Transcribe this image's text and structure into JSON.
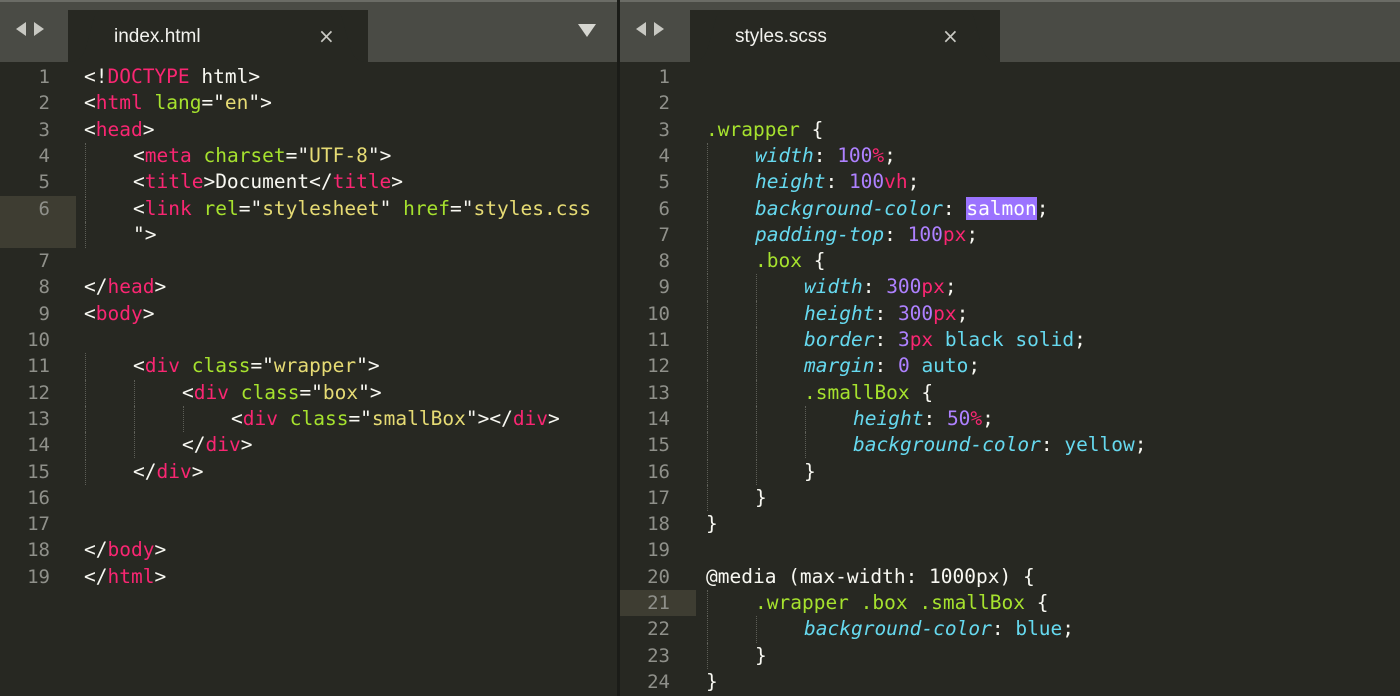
{
  "left_pane": {
    "tab_title": "index.html",
    "close_icon": "×",
    "highlighted_line": 6,
    "lines": [
      {
        "n": "1",
        "indent": 0,
        "tokens": [
          [
            "p",
            "<!"
          ],
          [
            "tag",
            "DOCTYPE"
          ],
          [
            "p",
            " html>"
          ]
        ]
      },
      {
        "n": "2",
        "indent": 0,
        "tokens": [
          [
            "p",
            "<"
          ],
          [
            "tag",
            "html"
          ],
          [
            "p",
            " "
          ],
          [
            "attr",
            "lang"
          ],
          [
            "p",
            "=\""
          ],
          [
            "str",
            "en"
          ],
          [
            "p",
            "\">"
          ]
        ]
      },
      {
        "n": "3",
        "indent": 0,
        "tokens": [
          [
            "p",
            "<"
          ],
          [
            "tag",
            "head"
          ],
          [
            "p",
            ">"
          ]
        ]
      },
      {
        "n": "4",
        "indent": 1,
        "tokens": [
          [
            "p",
            "<"
          ],
          [
            "tag",
            "meta"
          ],
          [
            "p",
            " "
          ],
          [
            "attr",
            "charset"
          ],
          [
            "p",
            "=\""
          ],
          [
            "str",
            "UTF-8"
          ],
          [
            "p",
            "\">"
          ]
        ]
      },
      {
        "n": "5",
        "indent": 1,
        "tokens": [
          [
            "p",
            "<"
          ],
          [
            "tag",
            "title"
          ],
          [
            "p",
            ">Document</"
          ],
          [
            "tag",
            "title"
          ],
          [
            "p",
            ">"
          ]
        ]
      },
      {
        "n": "6",
        "indent": 1,
        "tokens": [
          [
            "p",
            "<"
          ],
          [
            "tag",
            "link"
          ],
          [
            "p",
            " "
          ],
          [
            "attr",
            "rel"
          ],
          [
            "p",
            "=\""
          ],
          [
            "str",
            "stylesheet"
          ],
          [
            "p",
            "\" "
          ],
          [
            "attr",
            "href"
          ],
          [
            "p",
            "=\""
          ],
          [
            "str",
            "styles.css"
          ]
        ]
      },
      {
        "n": "",
        "indent": 1,
        "tokens": [
          [
            "p",
            "\">"
          ]
        ]
      },
      {
        "n": "7",
        "indent": 0,
        "tokens": []
      },
      {
        "n": "8",
        "indent": 0,
        "tokens": [
          [
            "p",
            "</"
          ],
          [
            "tag",
            "head"
          ],
          [
            "p",
            ">"
          ]
        ]
      },
      {
        "n": "9",
        "indent": 0,
        "tokens": [
          [
            "p",
            "<"
          ],
          [
            "tag",
            "body"
          ],
          [
            "p",
            ">"
          ]
        ]
      },
      {
        "n": "10",
        "indent": 0,
        "tokens": []
      },
      {
        "n": "11",
        "indent": 1,
        "tokens": [
          [
            "p",
            "<"
          ],
          [
            "tag",
            "div"
          ],
          [
            "p",
            " "
          ],
          [
            "attr",
            "class"
          ],
          [
            "p",
            "=\""
          ],
          [
            "str",
            "wrapper"
          ],
          [
            "p",
            "\">"
          ]
        ]
      },
      {
        "n": "12",
        "indent": 2,
        "tokens": [
          [
            "p",
            "<"
          ],
          [
            "tag",
            "div"
          ],
          [
            "p",
            " "
          ],
          [
            "attr",
            "class"
          ],
          [
            "p",
            "=\""
          ],
          [
            "str",
            "box"
          ],
          [
            "p",
            "\">"
          ]
        ]
      },
      {
        "n": "13",
        "indent": 3,
        "tokens": [
          [
            "p",
            "<"
          ],
          [
            "tag",
            "div"
          ],
          [
            "p",
            " "
          ],
          [
            "attr",
            "class"
          ],
          [
            "p",
            "=\""
          ],
          [
            "str",
            "smallBox"
          ],
          [
            "p",
            "\"></"
          ],
          [
            "tag",
            "div"
          ],
          [
            "p",
            ">"
          ]
        ]
      },
      {
        "n": "14",
        "indent": 2,
        "tokens": [
          [
            "p",
            "</"
          ],
          [
            "tag",
            "div"
          ],
          [
            "p",
            ">"
          ]
        ]
      },
      {
        "n": "15",
        "indent": 1,
        "tokens": [
          [
            "p",
            "</"
          ],
          [
            "tag",
            "div"
          ],
          [
            "p",
            ">"
          ]
        ]
      },
      {
        "n": "16",
        "indent": 0,
        "tokens": []
      },
      {
        "n": "17",
        "indent": 0,
        "tokens": []
      },
      {
        "n": "18",
        "indent": 0,
        "tokens": [
          [
            "p",
            "</"
          ],
          [
            "tag",
            "body"
          ],
          [
            "p",
            ">"
          ]
        ]
      },
      {
        "n": "19",
        "indent": 0,
        "tokens": [
          [
            "p",
            "</"
          ],
          [
            "tag",
            "html"
          ],
          [
            "p",
            ">"
          ]
        ]
      }
    ]
  },
  "right_pane": {
    "tab_title": "styles.scss",
    "close_icon": "×",
    "highlighted_line": 21,
    "lines": [
      {
        "n": "1",
        "indent": 0,
        "tokens": []
      },
      {
        "n": "2",
        "indent": 0,
        "tokens": []
      },
      {
        "n": "3",
        "indent": 0,
        "tokens": [
          [
            "sel",
            ".wrapper"
          ],
          [
            "p",
            " {"
          ]
        ]
      },
      {
        "n": "4",
        "indent": 1,
        "tokens": [
          [
            "prop",
            "width"
          ],
          [
            "p",
            ": "
          ],
          [
            "num",
            "100"
          ],
          [
            "unit",
            "%"
          ],
          [
            "p",
            ";"
          ]
        ]
      },
      {
        "n": "5",
        "indent": 1,
        "tokens": [
          [
            "prop",
            "height"
          ],
          [
            "p",
            ": "
          ],
          [
            "num",
            "100"
          ],
          [
            "unit",
            "vh"
          ],
          [
            "p",
            ";"
          ]
        ]
      },
      {
        "n": "6",
        "indent": 1,
        "tokens": [
          [
            "prop",
            "background-color"
          ],
          [
            "p",
            ": "
          ],
          [
            "hl",
            "salmon"
          ],
          [
            "p",
            ";"
          ]
        ]
      },
      {
        "n": "7",
        "indent": 1,
        "tokens": [
          [
            "prop",
            "padding-top"
          ],
          [
            "p",
            ": "
          ],
          [
            "num",
            "100"
          ],
          [
            "unit",
            "px"
          ],
          [
            "p",
            ";"
          ]
        ]
      },
      {
        "n": "8",
        "indent": 1,
        "tokens": [
          [
            "sel",
            ".box"
          ],
          [
            "p",
            " {"
          ]
        ]
      },
      {
        "n": "9",
        "indent": 2,
        "tokens": [
          [
            "prop",
            "width"
          ],
          [
            "p",
            ": "
          ],
          [
            "num",
            "300"
          ],
          [
            "unit",
            "px"
          ],
          [
            "p",
            ";"
          ]
        ]
      },
      {
        "n": "10",
        "indent": 2,
        "tokens": [
          [
            "prop",
            "height"
          ],
          [
            "p",
            ": "
          ],
          [
            "num",
            "300"
          ],
          [
            "unit",
            "px"
          ],
          [
            "p",
            ";"
          ]
        ]
      },
      {
        "n": "11",
        "indent": 2,
        "tokens": [
          [
            "prop",
            "border"
          ],
          [
            "p",
            ": "
          ],
          [
            "num",
            "3"
          ],
          [
            "unit",
            "px"
          ],
          [
            "p",
            " "
          ],
          [
            "kw",
            "black solid"
          ],
          [
            "p",
            ";"
          ]
        ]
      },
      {
        "n": "12",
        "indent": 2,
        "tokens": [
          [
            "prop",
            "margin"
          ],
          [
            "p",
            ": "
          ],
          [
            "num",
            "0"
          ],
          [
            "p",
            " "
          ],
          [
            "kw",
            "auto"
          ],
          [
            "p",
            ";"
          ]
        ]
      },
      {
        "n": "13",
        "indent": 2,
        "tokens": [
          [
            "sel",
            ".smallBox"
          ],
          [
            "p",
            " {"
          ]
        ]
      },
      {
        "n": "14",
        "indent": 3,
        "tokens": [
          [
            "prop",
            "height"
          ],
          [
            "p",
            ": "
          ],
          [
            "num",
            "50"
          ],
          [
            "unit",
            "%"
          ],
          [
            "p",
            ";"
          ]
        ]
      },
      {
        "n": "15",
        "indent": 3,
        "tokens": [
          [
            "prop",
            "background-color"
          ],
          [
            "p",
            ": "
          ],
          [
            "kw",
            "yellow"
          ],
          [
            "p",
            ";"
          ]
        ]
      },
      {
        "n": "16",
        "indent": 2,
        "tokens": [
          [
            "p",
            "}"
          ]
        ]
      },
      {
        "n": "17",
        "indent": 1,
        "tokens": [
          [
            "p",
            "}"
          ]
        ]
      },
      {
        "n": "18",
        "indent": 0,
        "tokens": [
          [
            "p",
            "}"
          ]
        ]
      },
      {
        "n": "19",
        "indent": 0,
        "tokens": []
      },
      {
        "n": "20",
        "indent": 0,
        "tokens": [
          [
            "p",
            "@media (max-width: 1000px) {"
          ]
        ]
      },
      {
        "n": "21",
        "indent": 1,
        "tokens": [
          [
            "sel",
            ".wrapper .box .smallBox"
          ],
          [
            "p",
            " {"
          ]
        ]
      },
      {
        "n": "22",
        "indent": 2,
        "tokens": [
          [
            "prop",
            "background-color"
          ],
          [
            "p",
            ": "
          ],
          [
            "kw",
            "blue"
          ],
          [
            "p",
            ";"
          ]
        ]
      },
      {
        "n": "23",
        "indent": 1,
        "tokens": [
          [
            "p",
            "}"
          ]
        ]
      },
      {
        "n": "24",
        "indent": 0,
        "tokens": [
          [
            "p",
            "}"
          ]
        ]
      }
    ]
  },
  "icons": {
    "back": "back-arrow-icon",
    "forward": "forward-arrow-icon",
    "close": "close-icon",
    "menu": "dropdown-triangle-icon"
  },
  "theme": {
    "background": "#272822",
    "tabbar": "#4a4b45",
    "tag": "#f92672",
    "attr": "#a6e22e",
    "string": "#e6db74",
    "property": "#66d9ef",
    "number": "#ae81ff",
    "selection": "#9b73ff",
    "line_highlight": "#3e3d32"
  }
}
